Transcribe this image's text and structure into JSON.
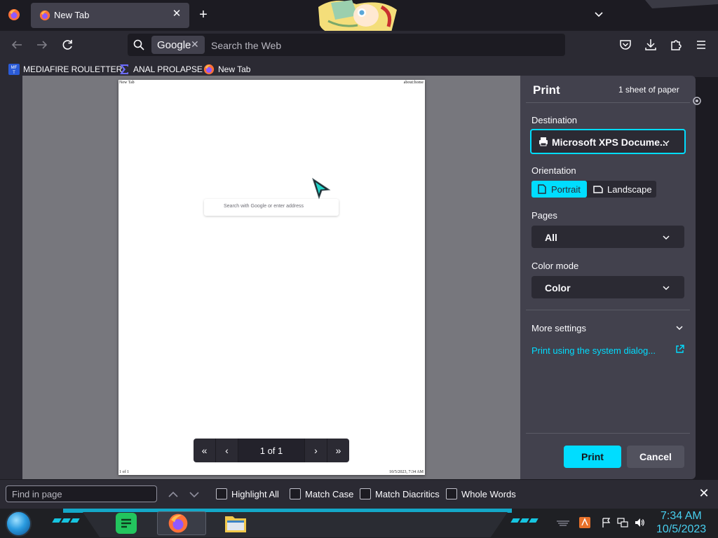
{
  "browser": {
    "tab": {
      "title": "New Tab"
    },
    "urlbar": {
      "engine_chip": "Google",
      "placeholder": "Search the Web"
    },
    "bookmarks": [
      {
        "label": "MEDIAFIRE ROULETTER",
        "icon": "mediafire-icon"
      },
      {
        "label": "ANAL PROLAPSE",
        "icon": "sigma-icon"
      },
      {
        "label": "New Tab",
        "icon": "firefox-icon"
      }
    ]
  },
  "preview": {
    "header_left": "New Tab",
    "header_right": "about:home",
    "search_placeholder": "Search with Google or enter address",
    "footer_left": "1 of 1",
    "footer_right": "10/5/2023, 7:34 AM",
    "pager": {
      "label": "1 of 1"
    }
  },
  "print_panel": {
    "title": "Print",
    "sheet_count": "1 sheet of paper",
    "destination": {
      "label": "Destination",
      "value": "Microsoft XPS Docume..."
    },
    "orientation": {
      "label": "Orientation",
      "portrait": "Portrait",
      "landscape": "Landscape",
      "selected": "Portrait"
    },
    "pages": {
      "label": "Pages",
      "value": "All"
    },
    "color_mode": {
      "label": "Color mode",
      "value": "Color"
    },
    "more_settings": "More settings",
    "system_dialog": "Print using the system dialog...",
    "print_button": "Print",
    "cancel_button": "Cancel",
    "accent_color": "#00ddff"
  },
  "findbar": {
    "placeholder": "Find in page",
    "options": [
      "Highlight All",
      "Match Case",
      "Match Diacritics",
      "Whole Words"
    ]
  },
  "taskbar": {
    "clock_time": "7:34 AM",
    "clock_date": "10/5/2023",
    "accent_color": "#16c5e0"
  }
}
